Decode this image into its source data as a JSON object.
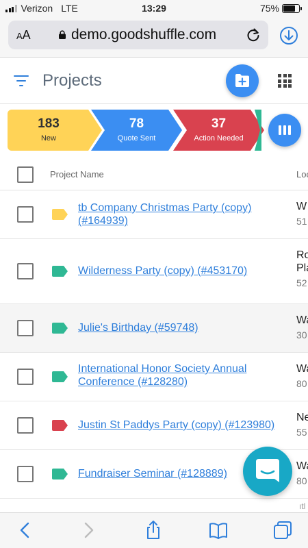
{
  "status_bar": {
    "carrier": "Verizon",
    "network": "LTE",
    "time": "13:29",
    "battery_percent": "75%",
    "battery_level": 0.75
  },
  "browser": {
    "text_size_label_small": "A",
    "text_size_label_large": "A",
    "domain": "demo.goodshuffle.com"
  },
  "header": {
    "title": "Projects",
    "filter_icon": "filter-lines-icon",
    "new_project_icon": "folder-plus-icon",
    "apps_icon": "grid-apps-icon"
  },
  "pipeline": {
    "stages": [
      {
        "count": "183",
        "label": "New",
        "color": "#ffd357"
      },
      {
        "count": "78",
        "label": "Quote Sent",
        "color": "#3b8ef2"
      },
      {
        "count": "37",
        "label": "Action Needed",
        "color": "#d9424f"
      }
    ],
    "next_stage_color": "#2fb894",
    "columns_icon": "columns-icon"
  },
  "table": {
    "headers": {
      "project_name": "Project Name",
      "location": "Loc"
    },
    "rows": [
      {
        "name": "tb Company Christmas Party (copy) (#164939)",
        "tag_color": "#ffd357",
        "location": "W",
        "location_sub": "51"
      },
      {
        "name": "Wilderness Party (copy) (#453170)",
        "tag_color": "#2fb894",
        "location": "Ro",
        "location_line2": "Pla",
        "location_sub": "52"
      },
      {
        "name": "Julie's Birthday (#59748)",
        "tag_color": "#2fb894",
        "location": "Wa",
        "location_sub": "30"
      },
      {
        "name": "International Honor Society Annual Conference (#128280)",
        "tag_color": "#2fb894",
        "location": "Wa",
        "location_sub": "80"
      },
      {
        "name": "Justin St Paddys Party (copy) (#123980)",
        "tag_color": "#d9424f",
        "location": "Ne",
        "location_sub": "55"
      },
      {
        "name": "Fundraiser Seminar (#128889)",
        "tag_color": "#2fb894",
        "location": "Wa",
        "location_sub": "80"
      }
    ],
    "partial_row_location": "ıtl"
  },
  "chat": {
    "icon": "chat-bubble-icon",
    "color": "#18a8c6"
  },
  "toolbar": {
    "icons": [
      "back-icon",
      "forward-icon",
      "share-icon",
      "bookmarks-icon",
      "tabs-icon"
    ]
  }
}
